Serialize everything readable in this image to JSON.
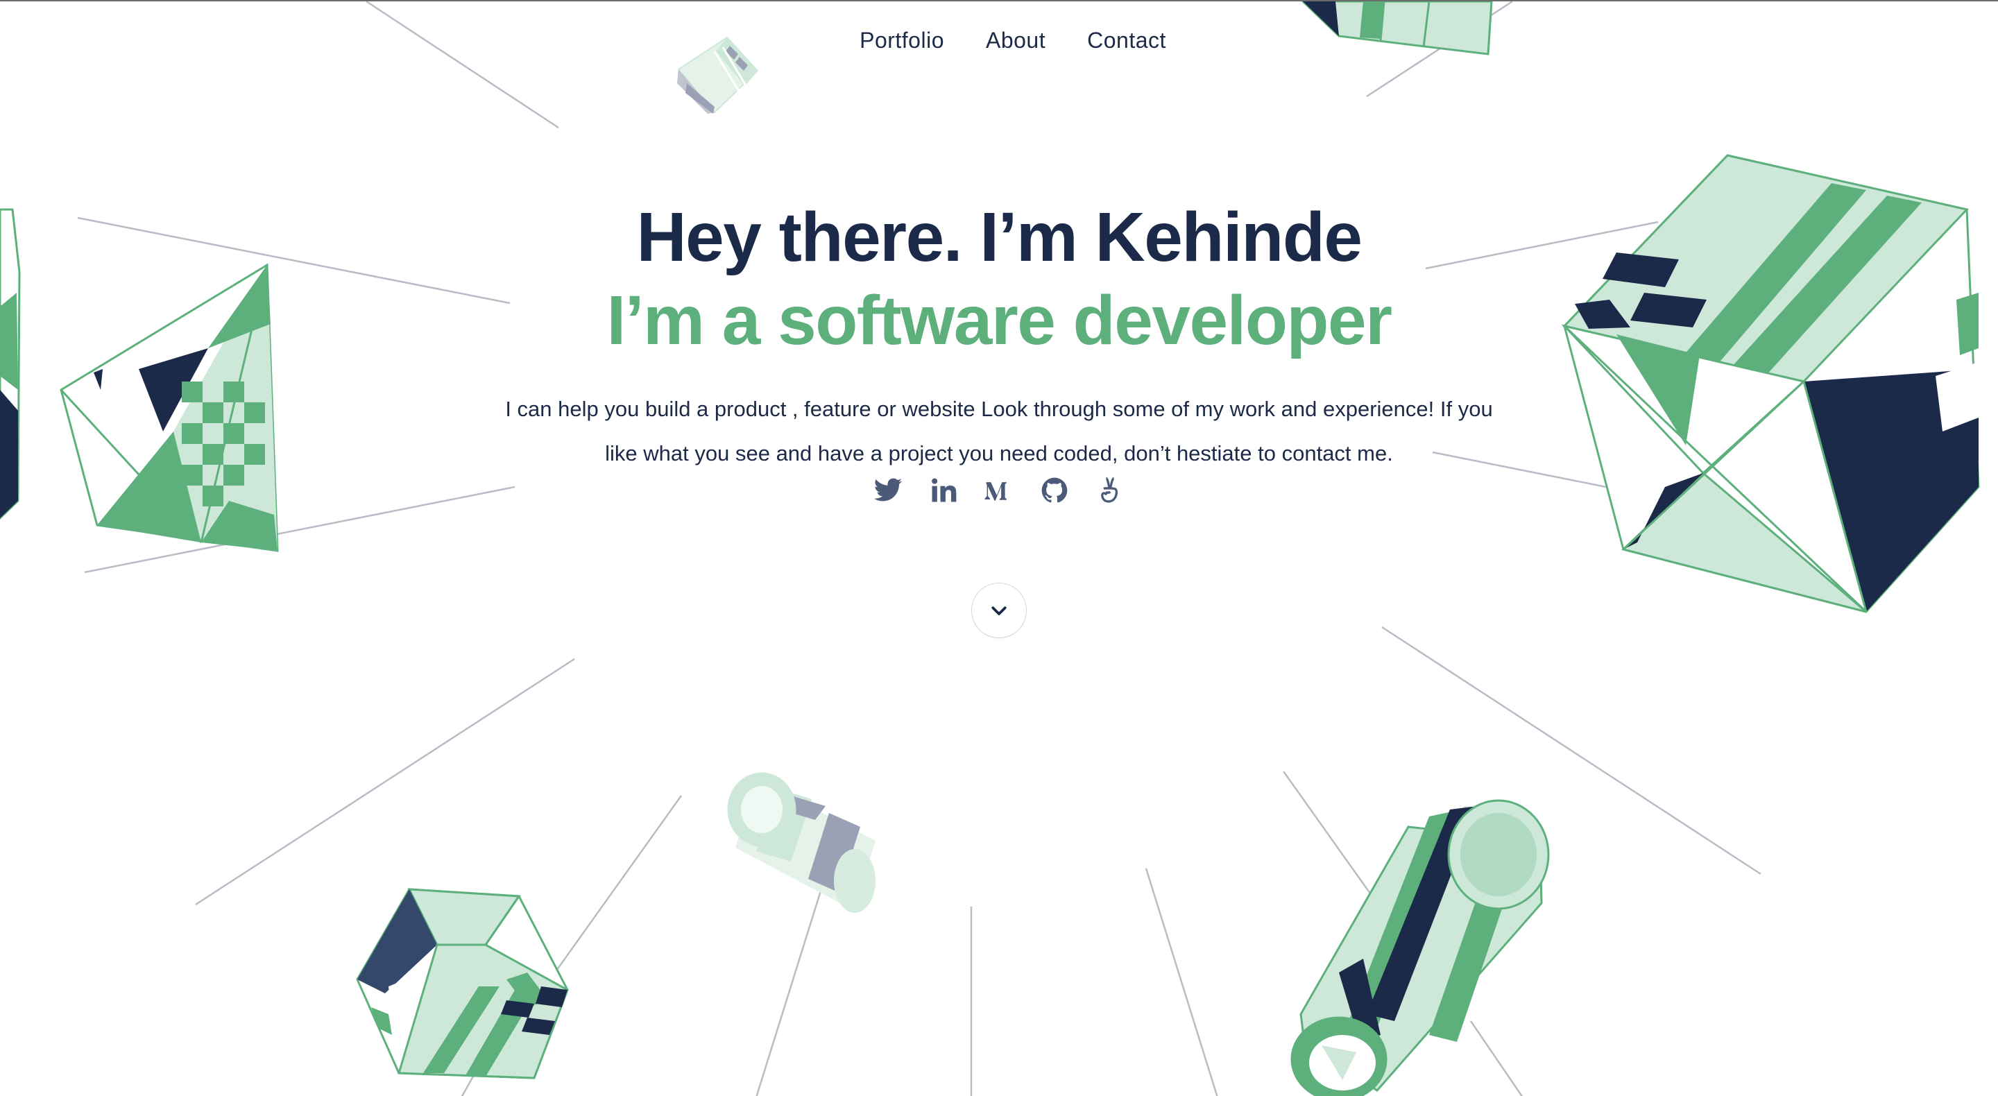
{
  "nav": {
    "items": [
      {
        "label": "Portfolio"
      },
      {
        "label": "About"
      },
      {
        "label": "Contact"
      }
    ]
  },
  "hero": {
    "title": "Hey there. I’m Kehinde",
    "subtitle": "I’m a software developer",
    "description": "I can help you build a product , feature or website Look through some of my work and experience! If you like what you see and have a project you need coded, don’t hestiate to contact me."
  },
  "socials": [
    {
      "icon": "twitter-icon"
    },
    {
      "icon": "linkedin-icon"
    },
    {
      "icon": "medium-icon"
    },
    {
      "icon": "github-icon"
    },
    {
      "icon": "angellist-icon"
    }
  ],
  "scroll_button": {
    "icon": "chevron-down-icon"
  },
  "colors": {
    "navy": "#1c2a4a",
    "green": "#5db07c",
    "mint": "#cde8d9",
    "line_gray": "#b9bcc6",
    "slate": "#99a0b4"
  }
}
